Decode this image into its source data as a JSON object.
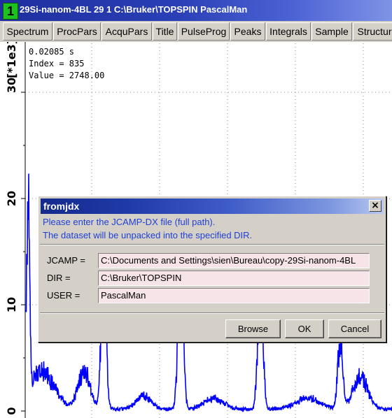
{
  "window": {
    "number": "1",
    "title": "29Si-nanom-4BL  29  1  C:\\Bruker\\TOPSPIN  PascalMan"
  },
  "tabs": [
    "Spectrum",
    "ProcPars",
    "AcquPars",
    "Title",
    "PulseProg",
    "Peaks",
    "Integrals",
    "Sample",
    "Structur"
  ],
  "readout": {
    "time": "0.02085 s",
    "index": "Index = 835",
    "value": "Value = 2748.00"
  },
  "yaxis": {
    "unit_label": "[*1e3]",
    "ticks": [
      "30",
      "20",
      "10",
      "0"
    ]
  },
  "dialog": {
    "title": "fromjdx",
    "close_glyph": "×",
    "message_line1": "Please enter the JCAMP-DX file (full path).",
    "message_line2": "The dataset will be unpacked into the specified DIR.",
    "fields": [
      {
        "label": "JCAMP =",
        "value": "C:\\Documents and Settings\\sien\\Bureau\\copy-29Si-nanom-4BL"
      },
      {
        "label": "DIR =",
        "value": "C:\\Bruker\\TOPSPIN"
      },
      {
        "label": "USER =",
        "value": "PascalMan"
      }
    ],
    "buttons": {
      "browse": "Browse",
      "ok": "OK",
      "cancel": "Cancel"
    }
  },
  "colors": {
    "trace": "#0000ff",
    "title_bar": "#2a3fb6",
    "field_bg": "#f6e4e8",
    "message_text": "#1f3fd6"
  }
}
